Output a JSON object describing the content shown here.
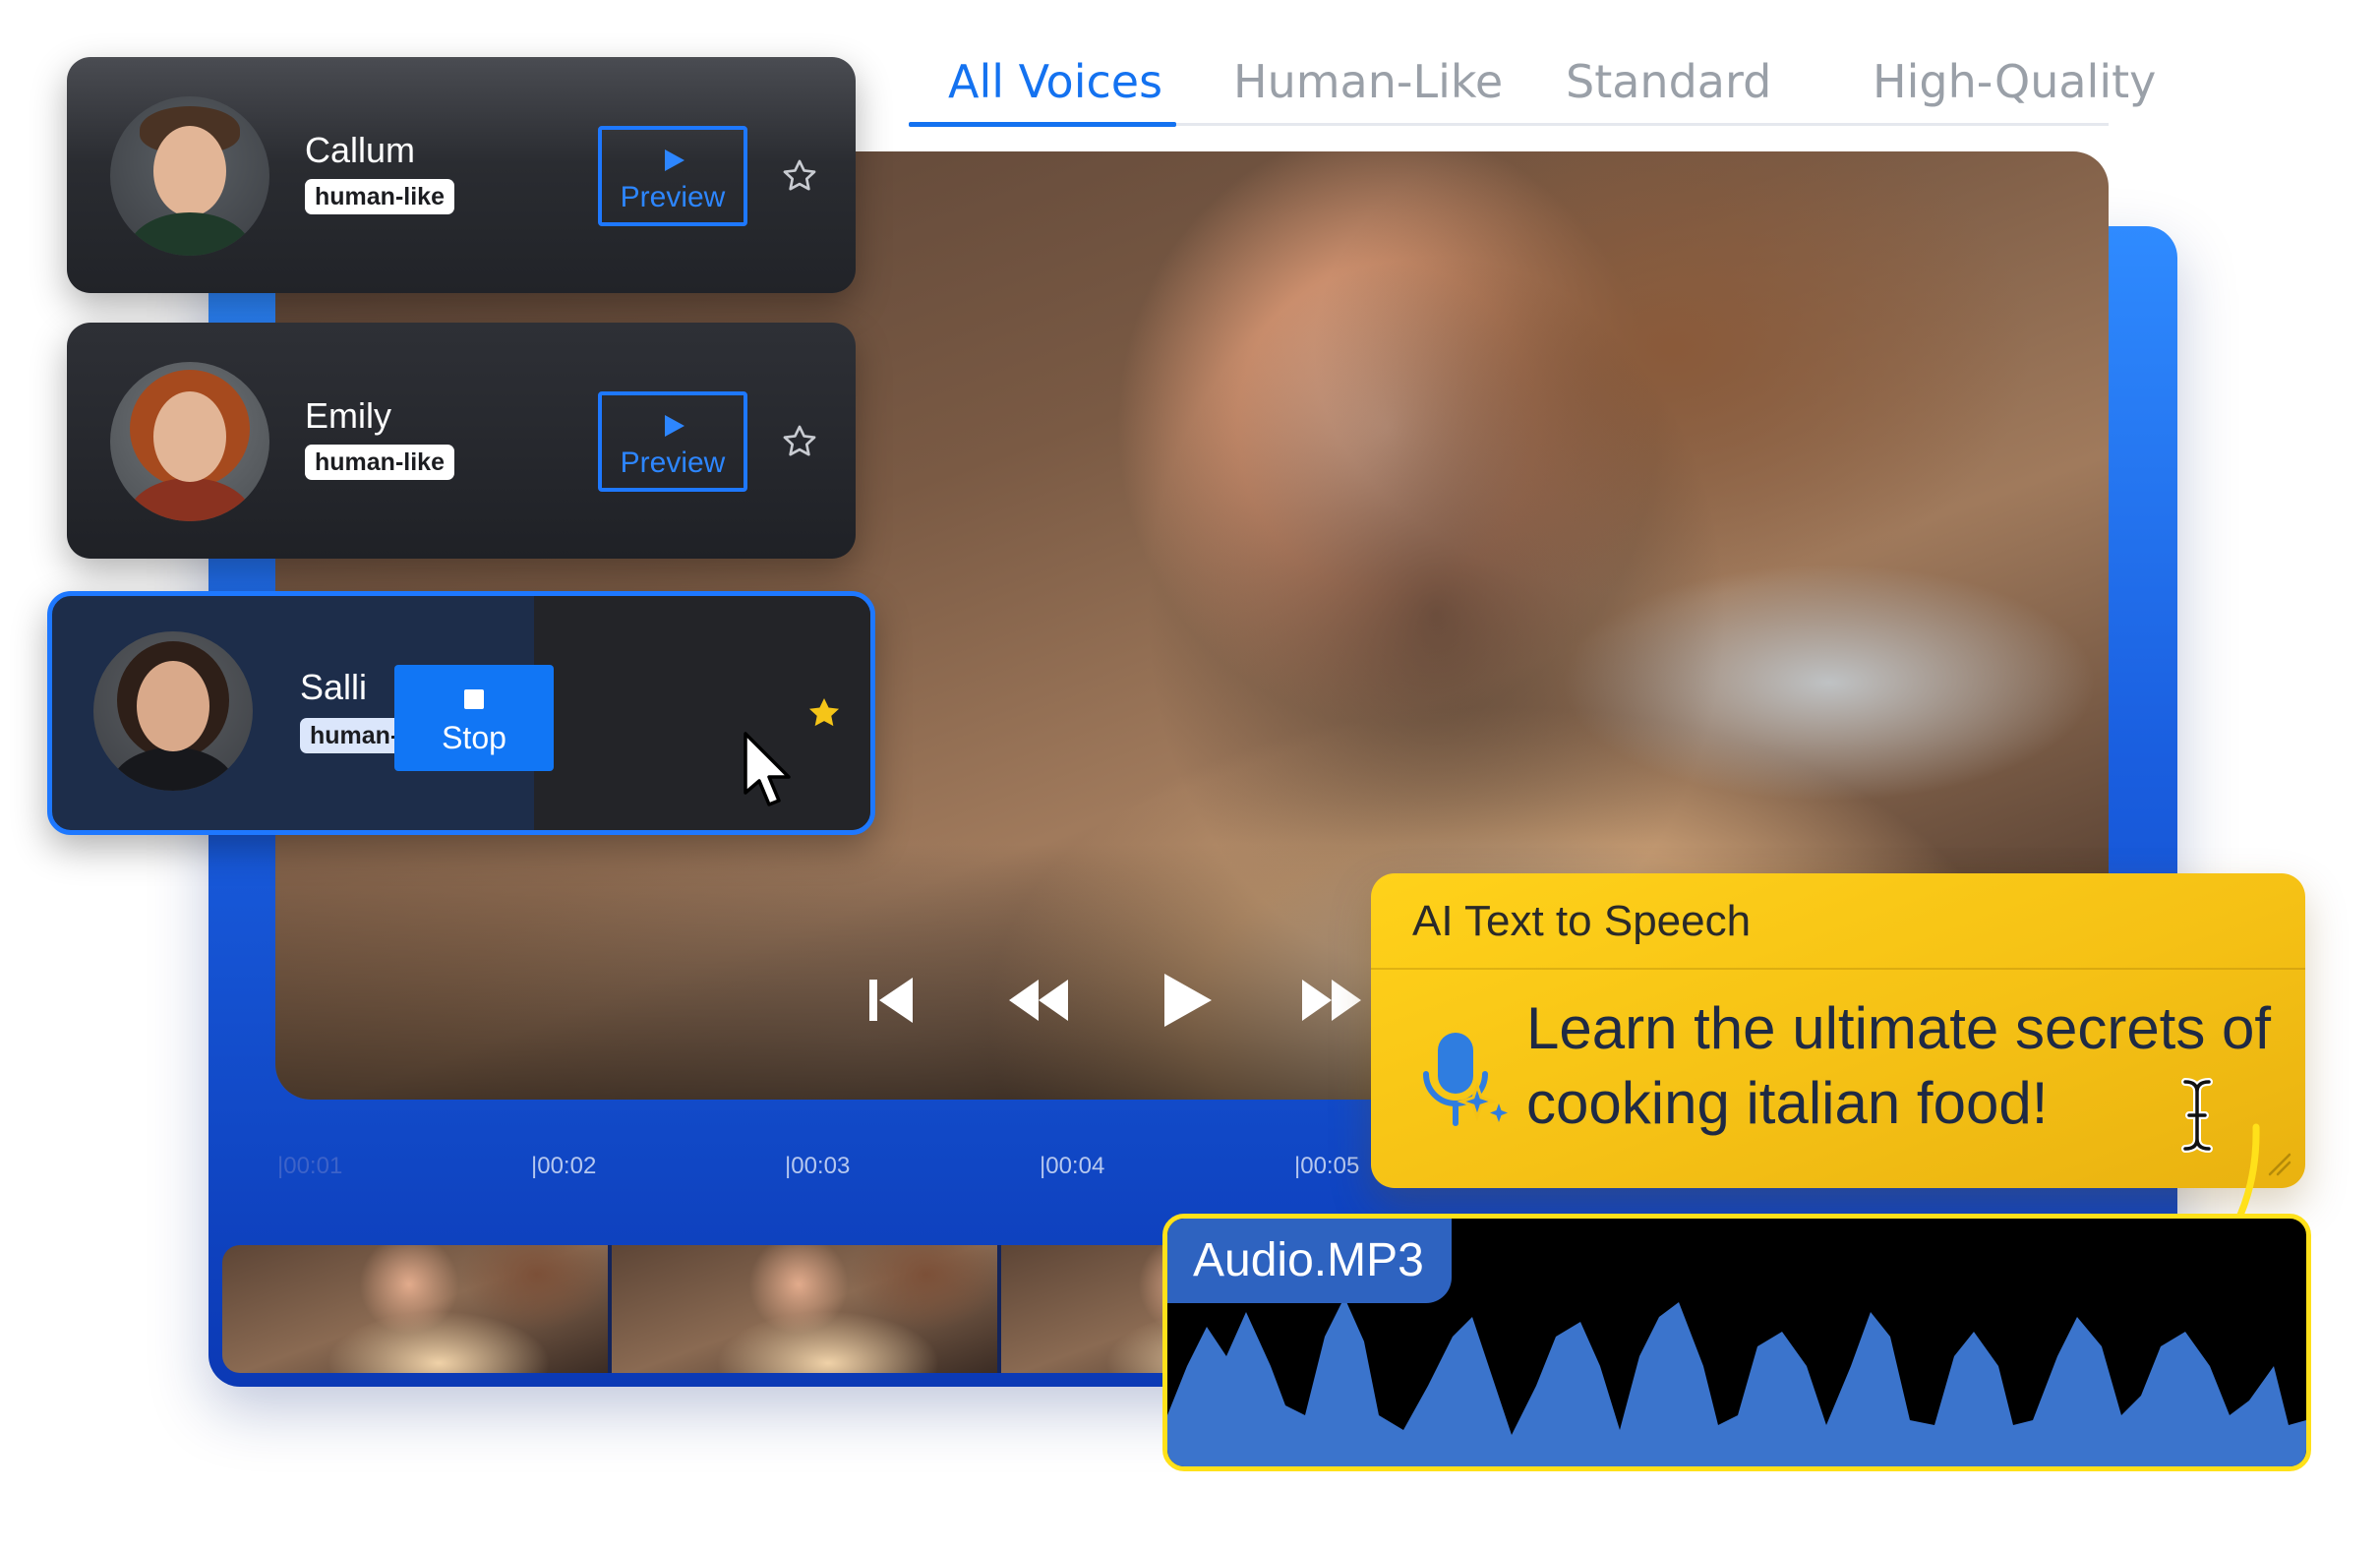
{
  "tabs": [
    {
      "label": "All Voices",
      "active": true
    },
    {
      "label": "Human-Like",
      "active": false
    },
    {
      "label": "Standard",
      "active": false
    },
    {
      "label": "High-Quality",
      "active": false
    }
  ],
  "voices": [
    {
      "name": "Callum",
      "tag": "human-like",
      "button": "Preview",
      "favorite": false
    },
    {
      "name": "Emily",
      "tag": "human-like",
      "button": "Preview",
      "favorite": false
    },
    {
      "name": "Salli",
      "tag": "human-like",
      "button": "Stop",
      "favorite": true,
      "selected": true
    }
  ],
  "player": {
    "controls": [
      "skip-back",
      "rewind",
      "play",
      "fast-forward"
    ]
  },
  "timeline": {
    "ticks": [
      "00:01",
      "00:02",
      "00:03",
      "00:04",
      "00:05"
    ]
  },
  "tts": {
    "title": "AI Text to Speech",
    "text": "Learn the ultimate secrets of cooking italian food!"
  },
  "audio": {
    "label": "Audio.MP3"
  },
  "colors": {
    "accent": "#1472f0",
    "frame": "#1a5fe0",
    "tts_background": "#f5c115",
    "audio_border": "#ffe11a",
    "waveform": "#3b74cc",
    "favorite_star": "#f5c518"
  }
}
